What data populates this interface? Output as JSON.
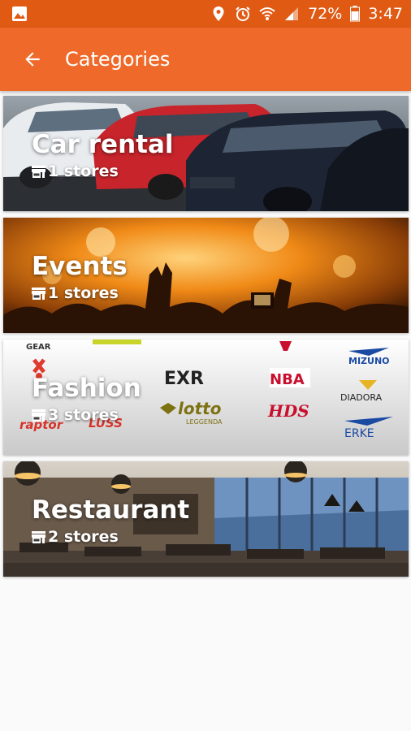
{
  "status_bar": {
    "battery": "72%",
    "time": "3:47",
    "icons": [
      "image-icon",
      "location-icon",
      "alarm-icon",
      "wifi-icon",
      "signal-icon",
      "battery-icon"
    ]
  },
  "app_bar": {
    "title": "Categories",
    "back_icon": "arrow-back-icon",
    "color": "#ef6a2a",
    "status_color": "#e05a14"
  },
  "categories": [
    {
      "name": "Car rental",
      "stores": "1 stores",
      "background": "cars-photo"
    },
    {
      "name": "Events",
      "stores": "1 stores",
      "background": "concert-photo"
    },
    {
      "name": "Fashion",
      "stores": "3 stores",
      "background": "brand-logos-photo",
      "logo_texts": [
        "GEAR",
        "EXR",
        "NBA",
        "MIZUNO",
        "DIADORA",
        "lotto",
        "LEGGENDA",
        "HDS",
        "ERKE",
        "raptor",
        "LUSS"
      ]
    },
    {
      "name": "Restaurant",
      "stores": "2 stores",
      "background": "restaurant-interior-photo"
    }
  ]
}
